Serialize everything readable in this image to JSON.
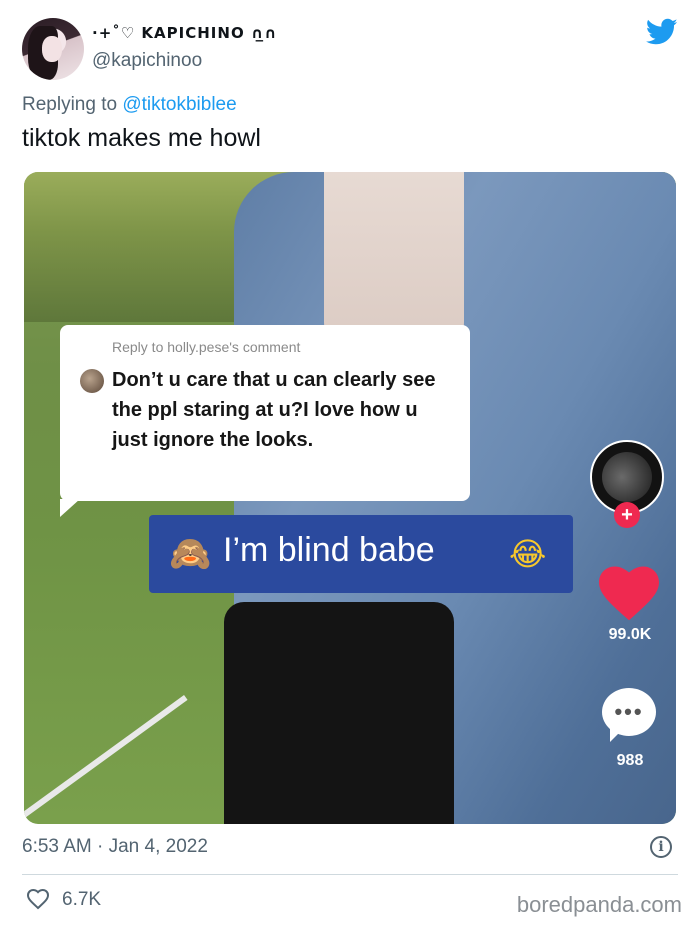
{
  "author": {
    "display_name": "·+˚♡ KAPICHINO ∩̲∩",
    "handle": "@kapichinoo"
  },
  "reply": {
    "prefix": "Replying to ",
    "target": "@tiktokbiblee"
  },
  "tweet_text": "tiktok makes me howl",
  "media": {
    "comment_header": "Reply to holly.pese's comment",
    "comment_body": "Don’t u care that u can clearly see the ppl staring at u?I love how u just ignore the looks.",
    "caption_text": "I’m blind babe",
    "caption_emoji_left": "🙈",
    "caption_emoji_right": "😂",
    "likes": "99.0K",
    "comments": "988",
    "plus_symbol": "+",
    "caption_bg": "#2b4a9e",
    "heart_color": "#ef2950"
  },
  "timestamp": "6:53 AM · Jan 4, 2022",
  "info_symbol": "i",
  "like_count": "6.7K",
  "watermark": "boredpanda.com",
  "colors": {
    "twitter_blue": "#1d9bf0",
    "secondary_text": "#536471"
  }
}
